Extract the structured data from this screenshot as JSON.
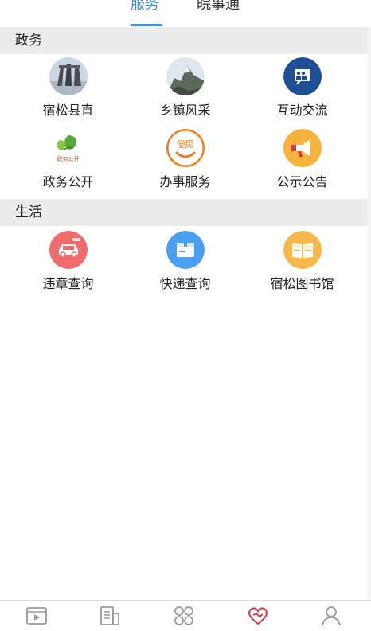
{
  "tabs": [
    {
      "label": "服务",
      "active": true
    },
    {
      "label": "皖事通",
      "active": false
    }
  ],
  "sections": [
    {
      "title": "政务",
      "items": [
        {
          "label": "宿松县直",
          "icon": "county-monument-icon"
        },
        {
          "label": "乡镇风采",
          "icon": "town-landscape-icon"
        },
        {
          "label": "互动交流",
          "icon": "chat-people-icon"
        },
        {
          "label": "政务公开",
          "icon": "gov-open-leaf-icon",
          "icon_text": "政务公开"
        },
        {
          "label": "办事服务",
          "icon": "convenience-people-icon",
          "icon_text": "便民"
        },
        {
          "label": "公示公告",
          "icon": "megaphone-icon"
        }
      ]
    },
    {
      "title": "生活",
      "items": [
        {
          "label": "违章查询",
          "icon": "car-icon"
        },
        {
          "label": "快递查询",
          "icon": "package-icon"
        },
        {
          "label": "宿松图书馆",
          "icon": "book-icon"
        }
      ]
    }
  ],
  "bottom_nav": [
    {
      "icon": "video-icon",
      "active": false
    },
    {
      "icon": "news-icon",
      "active": false
    },
    {
      "icon": "apps-grid-icon",
      "active": false
    },
    {
      "icon": "service-heart-icon",
      "active": true
    },
    {
      "icon": "user-profile-icon",
      "active": false
    }
  ],
  "colors": {
    "accent": "#4a8ed8",
    "active_nav": "#d9363e",
    "section_bg": "#ececec"
  }
}
